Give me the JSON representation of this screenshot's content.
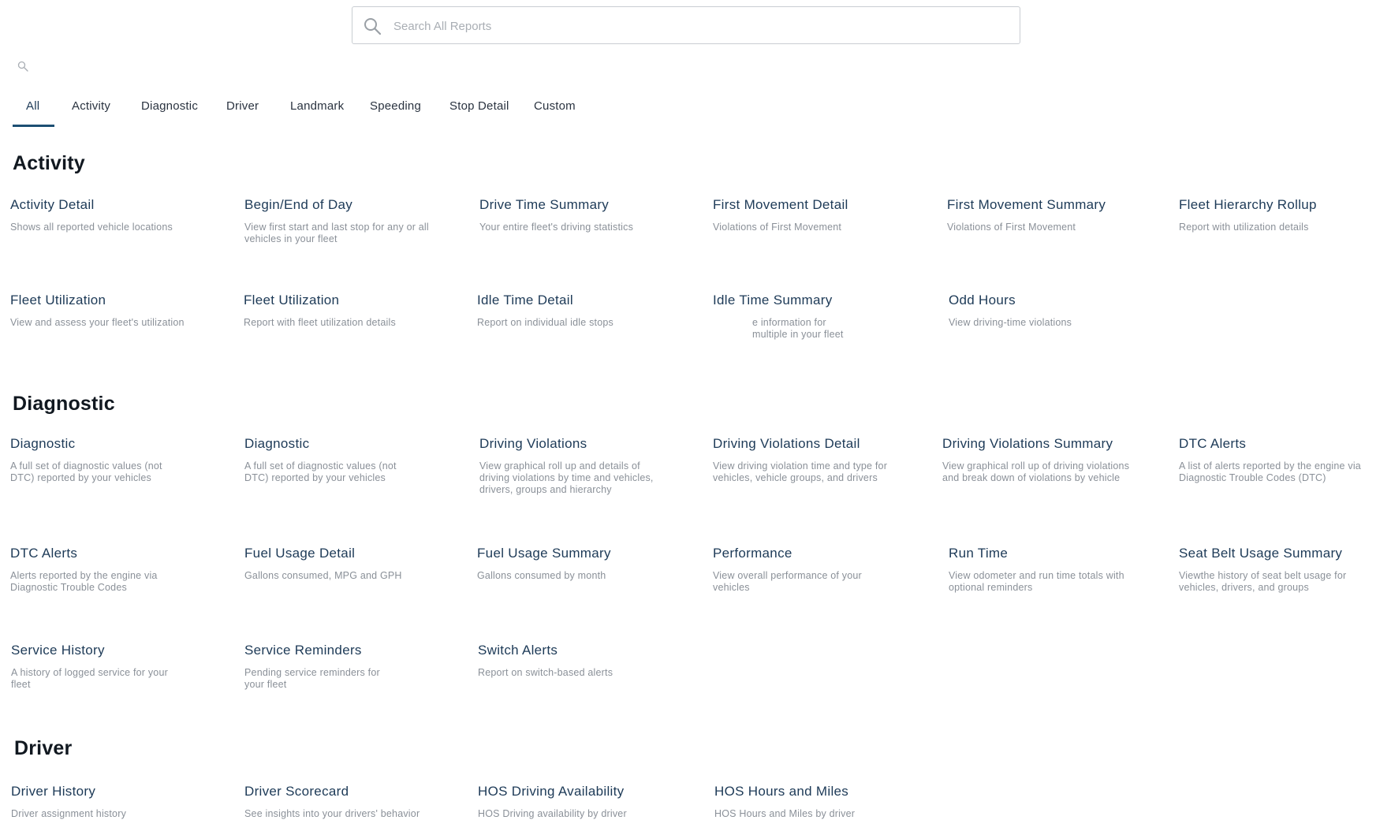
{
  "search": {
    "placeholder": "Search All Reports",
    "value": ""
  },
  "tabs": [
    "All",
    "Activity",
    "Diagnostic",
    "Driver",
    "Landmark",
    "Speeding",
    "Stop Detail",
    "Custom"
  ],
  "sections": [
    {
      "title": "Activity",
      "reports": [
        {
          "title": "Activity Detail",
          "desc": "Shows all reported vehicle locations"
        },
        {
          "title": "Begin/End of Day",
          "desc": "View first start and last stop for any or all vehicles in your fleet"
        },
        {
          "title": "Drive Time Summary",
          "desc": "Your entire fleet's driving statistics"
        },
        {
          "title": "First Movement Detail",
          "desc": "Violations of First Movement"
        },
        {
          "title": "First Movement Summary",
          "desc": "Violations of First Movement"
        },
        {
          "title": "Fleet Hierarchy Rollup",
          "desc": "Report with utilization details"
        },
        {
          "title": "Fleet Utilization",
          "desc": "View and assess your fleet's utilization"
        },
        {
          "title": "Fleet Utilization",
          "desc": "Report with fleet utilization details"
        },
        {
          "title": "Idle Time Detail",
          "desc": "Report on individual idle stops"
        },
        {
          "title": "Idle Time Summary",
          "desc": "e information for multiple in your fleet"
        },
        {
          "title": "Odd Hours",
          "desc": "View driving-time violations"
        }
      ]
    },
    {
      "title": "Diagnostic",
      "reports": [
        {
          "title": "Diagnostic",
          "desc": "A full set of diagnostic values (not DTC) reported by your vehicles"
        },
        {
          "title": "Diagnostic",
          "desc": "A full set of diagnostic values (not DTC) reported by your vehicles"
        },
        {
          "title": "Driving Violations",
          "desc": "View graphical roll up and details of driving violations by time and vehicles, drivers, groups and hierarchy"
        },
        {
          "title": "Driving Violations Detail",
          "desc": "View driving violation time and type for vehicles, vehicle groups, and drivers"
        },
        {
          "title": "Driving Violations Summary",
          "desc": "View graphical roll up of driving violations and break down of violations by vehicle"
        },
        {
          "title": "DTC Alerts",
          "desc": "A list of alerts reported by the engine via Diagnostic Trouble Codes (DTC)"
        },
        {
          "title": "DTC Alerts",
          "desc": "Alerts reported by the engine via Diagnostic Trouble Codes"
        },
        {
          "title": "Fuel Usage Detail",
          "desc": "Gallons consumed, MPG and GPH"
        },
        {
          "title": "Fuel Usage Summary",
          "desc": "Gallons consumed by month"
        },
        {
          "title": "Performance",
          "desc": "View overall performance of your vehicles"
        },
        {
          "title": "Run Time",
          "desc": "View odometer and run time totals with optional reminders"
        },
        {
          "title": "Seat Belt Usage Summary",
          "desc": "Viewthe history of seat belt usage for vehicles, drivers, and groups"
        },
        {
          "title": "Service History",
          "desc": "A history of logged service for your fleet"
        },
        {
          "title": "Service Reminders",
          "desc": "Pending service reminders for your fleet"
        },
        {
          "title": "Switch Alerts",
          "desc": "Report on switch-based alerts"
        }
      ]
    },
    {
      "title": "Driver",
      "reports": [
        {
          "title": "Driver History",
          "desc": "Driver assignment history"
        },
        {
          "title": "Driver Scorecard",
          "desc": "See insights into your drivers' behavior"
        },
        {
          "title": "HOS Driving Availability",
          "desc": "HOS Driving availability by driver"
        },
        {
          "title": "HOS Hours and Miles",
          "desc": "HOS Hours and Miles by driver"
        }
      ]
    }
  ]
}
